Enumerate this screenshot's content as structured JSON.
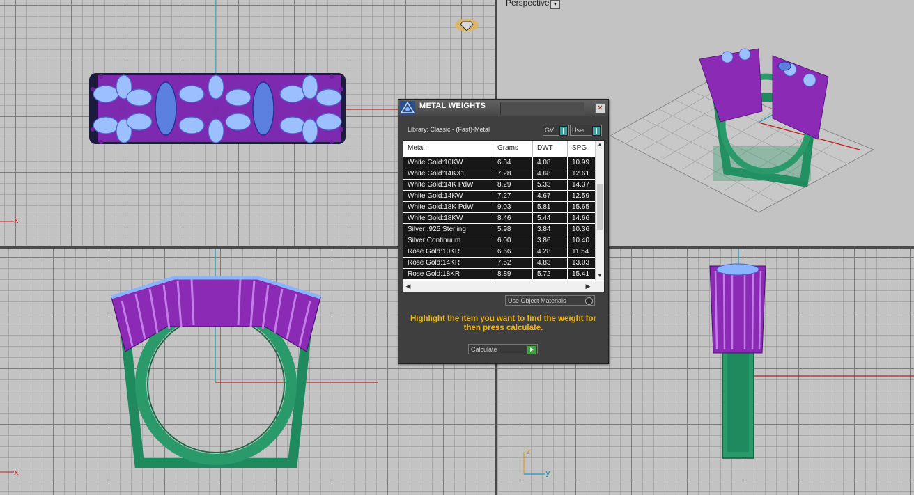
{
  "viewports": {
    "top": {
      "axis_letter": "x"
    },
    "perspective": {
      "label": "Perspective"
    },
    "front": {
      "axis_letter": "x"
    },
    "left": {
      "axis_z": "z",
      "axis_y": "y"
    }
  },
  "dialog": {
    "title": "METAL WEIGHTS",
    "library": "Library: Classic - (Fast)-Metal",
    "toggles": [
      {
        "label": "GV"
      },
      {
        "label": "User"
      }
    ],
    "columns": [
      "Metal",
      "Grams",
      "DWT",
      "SPG"
    ],
    "rows": [
      {
        "metal": "White Gold:10KW",
        "grams": "6.34",
        "dwt": "4.08",
        "spg": "10.99"
      },
      {
        "metal": "White Gold:14KX1",
        "grams": "7.28",
        "dwt": "4.68",
        "spg": "12.61"
      },
      {
        "metal": "White Gold:14K PdW",
        "grams": "8.29",
        "dwt": "5.33",
        "spg": "14.37"
      },
      {
        "metal": "White Gold:14KW",
        "grams": "7.27",
        "dwt": "4.67",
        "spg": "12.59"
      },
      {
        "metal": "White Gold:18K PdW",
        "grams": "9.03",
        "dwt": "5.81",
        "spg": "15.65"
      },
      {
        "metal": "White Gold:18KW",
        "grams": "8.46",
        "dwt": "5.44",
        "spg": "14.66"
      },
      {
        "metal": "Silver:.925 Sterling",
        "grams": "5.98",
        "dwt": "3.84",
        "spg": "10.36"
      },
      {
        "metal": "Silver:Continuum",
        "grams": "6.00",
        "dwt": "3.86",
        "spg": "10.40"
      },
      {
        "metal": "Rose Gold:10KR",
        "grams": "6.66",
        "dwt": "4.28",
        "spg": "11.54"
      },
      {
        "metal": "Rose Gold:14KR",
        "grams": "7.52",
        "dwt": "4.83",
        "spg": "13.03"
      },
      {
        "metal": "Rose Gold:18KR",
        "grams": "8.89",
        "dwt": "5.72",
        "spg": "15.41"
      }
    ],
    "use_object_materials": "Use Object Materials",
    "instructions": "Highlight the item you want to find the weight for then press calculate.",
    "calculate_label": "Calculate"
  },
  "colors": {
    "metal": "#2a9a6a",
    "prongs": "#8a2ab5",
    "gems": "#8ab4ff",
    "dialog_bg": "#3f3f3f",
    "instruction_text": "#f0b818"
  }
}
